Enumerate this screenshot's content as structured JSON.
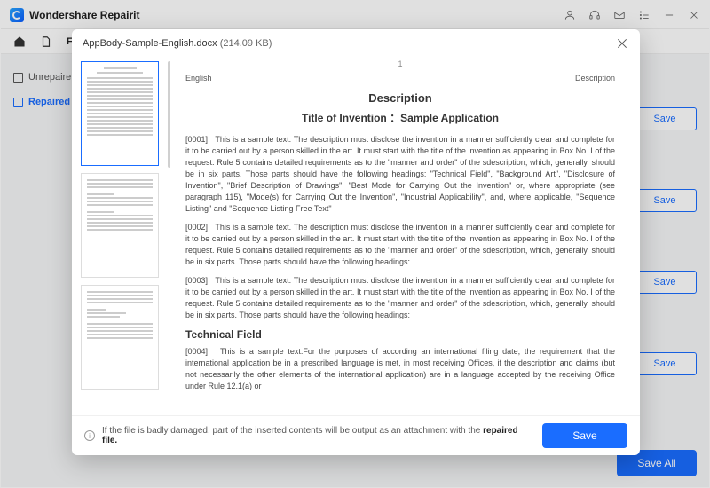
{
  "app": {
    "name": "Wondershare Repairit"
  },
  "toolbar": {
    "file_label": "File"
  },
  "sidebar": {
    "items": [
      {
        "label": "Unrepaire"
      },
      {
        "label": "Repaired"
      }
    ]
  },
  "bg_buttons": {
    "save": "Save",
    "save_all": "Save All"
  },
  "modal": {
    "filename": "AppBody-Sample-English.docx",
    "filesize": "(214.09 KB)",
    "page_number": "1",
    "top_left": "English",
    "top_right": "Description",
    "h1": "Description",
    "h2": "Title of Invention ：Sample Application",
    "paras": [
      {
        "num": "[0001]",
        "text": "This is a sample text. The description must disclose the invention in a manner sufficiently clear and complete for it to be carried out by a person skilled in the art. It must start with the title of the invention as appearing in Box No. I of the request. Rule 5 contains detailed requirements as to the \"manner and order\" of the sdescription, which, generally, should be in six parts. Those parts should have the following headings: \"Technical Field\", \"Background Art\", \"Disclosure of Invention\", \"Brief Description of Drawings\", \"Best Mode for Carrying Out the Invention\" or, where appropriate (see paragraph 115), \"Mode(s) for Carrying Out the Invention\", \"Industrial Applicability\", and, where applicable, \"Sequence Listing\" and \"Sequence Listing Free Text\""
      },
      {
        "num": "[0002]",
        "text": "This is a sample text. The description must disclose the invention in a manner sufficiently clear and complete for it to be carried out by a person skilled in the art. It must start with the title of the invention as appearing in Box No. I of the request. Rule 5 contains detailed requirements as to the \"manner and order\" of the sdescription, which, generally, should be in six parts. Those parts should have the following headings:"
      },
      {
        "num": "[0003]",
        "text": "This is a sample text. The description must disclose the invention in a manner sufficiently clear and complete for it to be carried out by a person skilled in the art. It must start with the title of the invention as appearing in Box No. I of the request. Rule 5 contains detailed requirements as to the \"manner and order\" of the sdescription, which, generally, should be in six parts. Those parts should have the following headings:"
      }
    ],
    "h3": "Technical Field",
    "para4": {
      "num": "[0004]",
      "text": "This is a sample text.For the purposes of according an international filing date, the requirement that the international application be in a prescribed language is met, in most receiving Offices, if the description and claims (but not necessarily the other elements of the international application) are in a language accepted by the receiving Office under Rule 12.1(a) or"
    },
    "footer_prefix": "If the file is badly damaged, part of the inserted contents will be output as an attachment with the ",
    "footer_bold": "repaired file.",
    "save": "Save"
  }
}
